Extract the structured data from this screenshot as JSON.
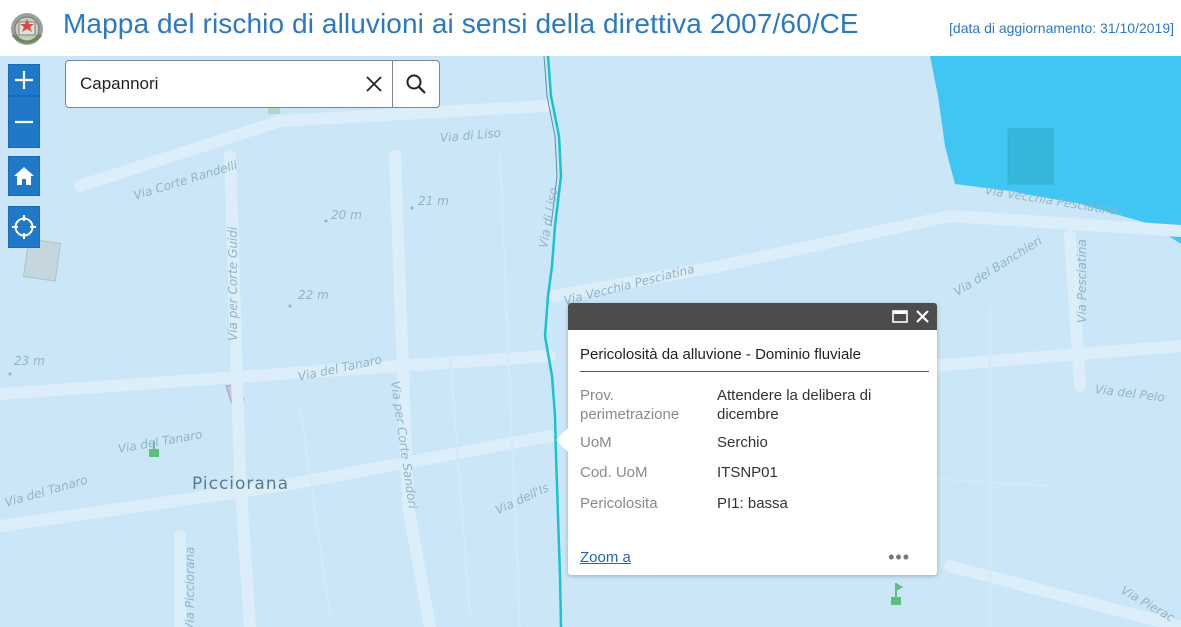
{
  "header": {
    "title": "Mappa del rischio di alluvioni ai sensi della direttiva 2007/60/CE",
    "update_label": "[data di aggiornamento: 31/10/2019]"
  },
  "controls": {
    "zoom_in_icon": "plus-icon",
    "zoom_out_icon": "minus-icon",
    "home_icon": "home-icon",
    "locate_icon": "locate-icon"
  },
  "search": {
    "value": "Capannori",
    "clear_icon": "close-icon",
    "search_icon": "search-icon"
  },
  "map": {
    "colors": {
      "land": "#cbe7f7",
      "water": "#3fc6f2",
      "river": "#17c3cf",
      "road": "#dceef9"
    },
    "labels": [
      "Via Corte Randelli",
      "Via di Liso",
      "Via di Liso",
      "Via per Corte Guidi",
      "Via Vecchia Pesciatina",
      "Via Vecchia Pesciatina",
      "Via del Banchieri",
      "Via Pesciatina",
      "Via del Tanaro",
      "Via del Tanaro",
      "Via del Tanaro",
      "Via per Corte Sandori",
      "Via dell'Is",
      "Via del Pelo",
      "Via Picciorana",
      "Via Pierac"
    ],
    "elevations": [
      "20 m",
      "21 m",
      "22 m",
      "23 m"
    ],
    "place": "Picciorana"
  },
  "popup": {
    "maximize_icon": "maximize-icon",
    "close_icon": "close-icon",
    "title": "Pericolosità da alluvione - Dominio fluviale",
    "attributes": [
      {
        "key": "Prov. perimetrazione",
        "value": "Attendere la delibera di dicembre"
      },
      {
        "key": "UoM",
        "value": "Serchio"
      },
      {
        "key": "Cod. UoM",
        "value": "ITSNP01"
      },
      {
        "key": "Pericolosita",
        "value": "PI1: bassa"
      }
    ],
    "zoom_label": "Zoom a",
    "more_label": "•••"
  }
}
